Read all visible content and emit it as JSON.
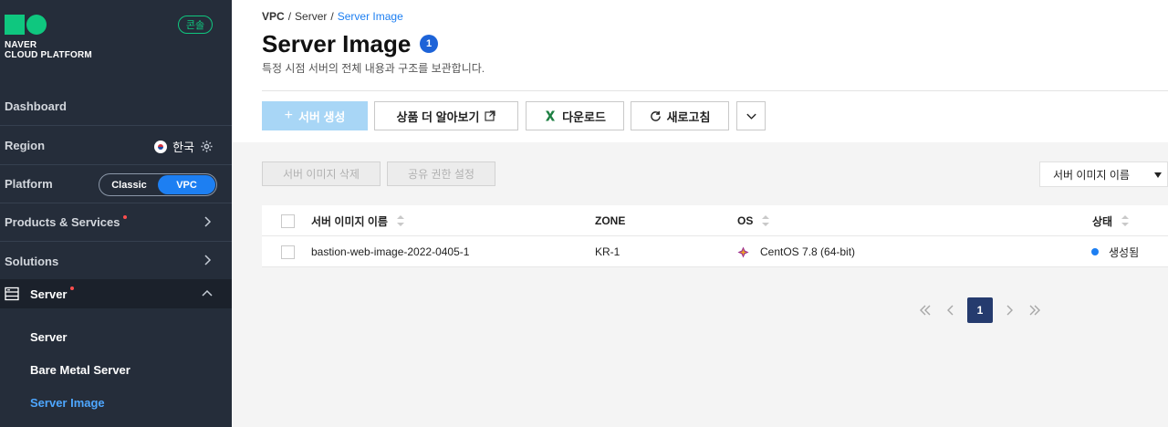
{
  "sidebar": {
    "logo_line1": "NAVER",
    "logo_line2": "CLOUD PLATFORM",
    "console_label": "콘솔",
    "dashboard": "Dashboard",
    "region_label": "Region",
    "region_value": "한국",
    "platform_label": "Platform",
    "platform_classic": "Classic",
    "platform_vpc": "VPC",
    "products": "Products & Services",
    "solutions": "Solutions",
    "server": "Server",
    "sub_items": [
      "Server",
      "Bare Metal Server",
      "Server Image"
    ]
  },
  "breadcrumb": {
    "b1": "VPC",
    "sep": "/",
    "b2": "Server",
    "b3": "Server Image"
  },
  "header": {
    "title": "Server Image",
    "count": "1",
    "subtitle": "특정 시점 서버의 전체 내용과 구조를 보관합니다."
  },
  "toolbar": {
    "create": "서버 생성",
    "learn_more": "상품 더 알아보기",
    "download": "다운로드",
    "refresh": "새로고침"
  },
  "actions": {
    "delete": "서버 이미지 삭제",
    "share": "공유 권한 설정",
    "sort_value": "서버 이미지 이름"
  },
  "table": {
    "headers": {
      "name": "서버 이미지 이름",
      "zone": "ZONE",
      "os": "OS",
      "status": "상태"
    },
    "rows": [
      {
        "name": "bastion-web-image-2022-0405-1",
        "zone": "KR-1",
        "os": "CentOS 7.8 (64-bit)",
        "status": "생성됨"
      }
    ]
  },
  "pagination": {
    "current": "1"
  },
  "colors": {
    "accent": "#1d7ff2",
    "sidebar_bg": "#252d3a",
    "brand": "#0fc77f"
  }
}
